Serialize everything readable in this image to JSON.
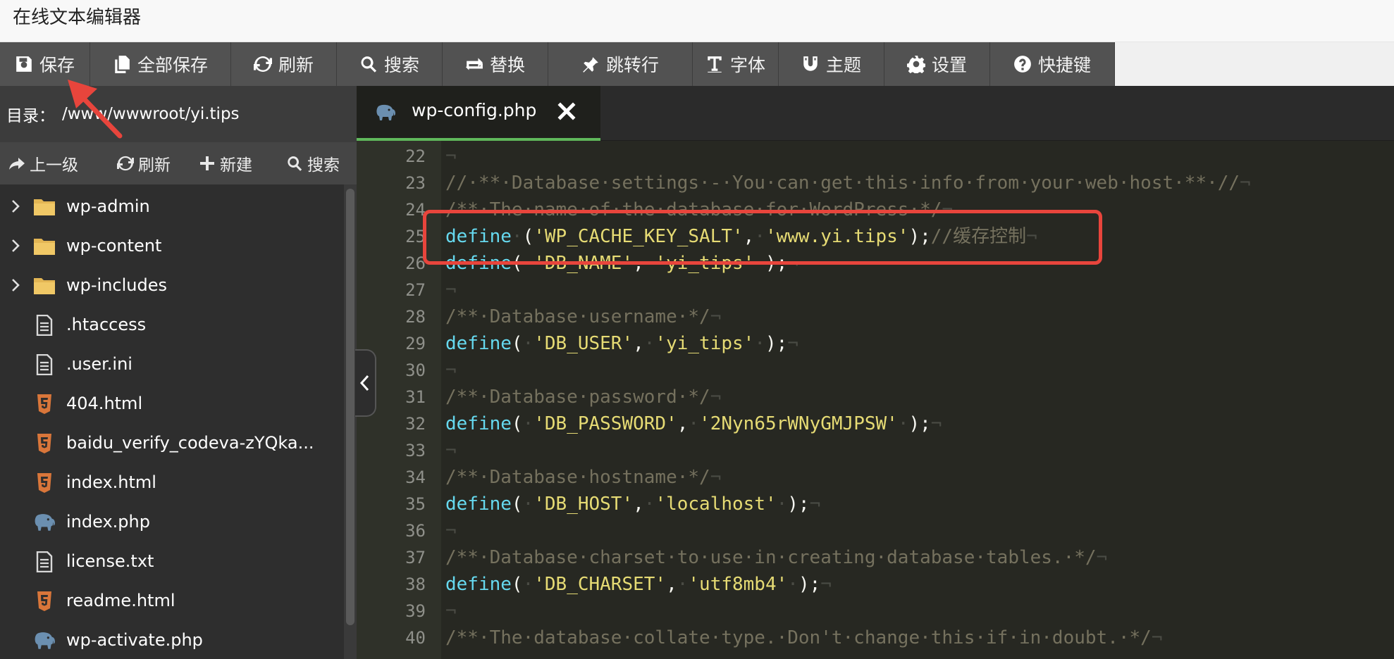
{
  "app": {
    "title": "在线文本编辑器"
  },
  "toolbar": {
    "save": "保存",
    "save_all": "全部保存",
    "refresh": "刷新",
    "search": "搜索",
    "replace": "替换",
    "goto_line": "跳转行",
    "font": "字体",
    "theme": "主题",
    "settings": "设置",
    "shortcuts": "快捷键"
  },
  "sidebar": {
    "dir_label": "目录：",
    "dir_path": "/www/wwwroot/yi.tips",
    "actions": {
      "up": "上一级",
      "refresh": "刷新",
      "new": "新建",
      "search": "搜索"
    },
    "files": [
      {
        "name": "wp-admin",
        "type": "folder"
      },
      {
        "name": "wp-content",
        "type": "folder"
      },
      {
        "name": "wp-includes",
        "type": "folder"
      },
      {
        "name": ".htaccess",
        "type": "text"
      },
      {
        "name": ".user.ini",
        "type": "text"
      },
      {
        "name": "404.html",
        "type": "html"
      },
      {
        "name": "baidu_verify_codeva-zYQka...",
        "type": "html"
      },
      {
        "name": "index.html",
        "type": "html"
      },
      {
        "name": "index.php",
        "type": "php"
      },
      {
        "name": "license.txt",
        "type": "text"
      },
      {
        "name": "readme.html",
        "type": "html"
      },
      {
        "name": "wp-activate.php",
        "type": "php"
      }
    ]
  },
  "editor": {
    "tab_name": "wp-config.php",
    "lines": [
      {
        "num": "22",
        "tokens": [
          {
            "t": "¬",
            "c": "inv"
          }
        ]
      },
      {
        "num": "23",
        "tokens": [
          {
            "t": "//·**·Database·settings·-·You·can·get·this·info·from·your·web·host·**·//",
            "c": "cm"
          },
          {
            "t": "¬",
            "c": "inv"
          }
        ]
      },
      {
        "num": "24",
        "tokens": [
          {
            "t": "/**·The·name·of·the·database·for·WordPress·*/",
            "c": "cm"
          },
          {
            "t": "¬",
            "c": "inv"
          }
        ]
      },
      {
        "num": "25",
        "tokens": [
          {
            "t": "define",
            "c": "kw"
          },
          {
            "t": "·",
            "c": "inv"
          },
          {
            "t": "(",
            "c": ""
          },
          {
            "t": "'WP_CACHE_KEY_SALT'",
            "c": "st"
          },
          {
            "t": ",",
            "c": ""
          },
          {
            "t": "·",
            "c": "inv"
          },
          {
            "t": "'www.yi.tips'",
            "c": "st"
          },
          {
            "t": ");",
            "c": ""
          },
          {
            "t": "//缓存控制",
            "c": "cm"
          },
          {
            "t": "¬",
            "c": "inv"
          }
        ]
      },
      {
        "num": "26",
        "tokens": [
          {
            "t": "define",
            "c": "kw"
          },
          {
            "t": "(",
            "c": ""
          },
          {
            "t": "·",
            "c": "inv"
          },
          {
            "t": "'DB_NAME'",
            "c": "st"
          },
          {
            "t": ",",
            "c": ""
          },
          {
            "t": "·",
            "c": "inv"
          },
          {
            "t": "'yi_tips'",
            "c": "st"
          },
          {
            "t": "·",
            "c": "inv"
          },
          {
            "t": ");",
            "c": ""
          },
          {
            "t": "¬",
            "c": "inv"
          }
        ]
      },
      {
        "num": "27",
        "tokens": [
          {
            "t": "¬",
            "c": "inv"
          }
        ]
      },
      {
        "num": "28",
        "tokens": [
          {
            "t": "/**·Database·username·*/",
            "c": "cm"
          },
          {
            "t": "¬",
            "c": "inv"
          }
        ]
      },
      {
        "num": "29",
        "tokens": [
          {
            "t": "define",
            "c": "kw"
          },
          {
            "t": "(",
            "c": ""
          },
          {
            "t": "·",
            "c": "inv"
          },
          {
            "t": "'DB_USER'",
            "c": "st"
          },
          {
            "t": ",",
            "c": ""
          },
          {
            "t": "·",
            "c": "inv"
          },
          {
            "t": "'yi_tips'",
            "c": "st"
          },
          {
            "t": "·",
            "c": "inv"
          },
          {
            "t": ");",
            "c": ""
          },
          {
            "t": "¬",
            "c": "inv"
          }
        ]
      },
      {
        "num": "30",
        "tokens": [
          {
            "t": "¬",
            "c": "inv"
          }
        ]
      },
      {
        "num": "31",
        "tokens": [
          {
            "t": "/**·Database·password·*/",
            "c": "cm"
          },
          {
            "t": "¬",
            "c": "inv"
          }
        ]
      },
      {
        "num": "32",
        "tokens": [
          {
            "t": "define",
            "c": "kw"
          },
          {
            "t": "(",
            "c": ""
          },
          {
            "t": "·",
            "c": "inv"
          },
          {
            "t": "'DB_PASSWORD'",
            "c": "st"
          },
          {
            "t": ",",
            "c": ""
          },
          {
            "t": "·",
            "c": "inv"
          },
          {
            "t": "'2Nyn65rWNyGMJPSW'",
            "c": "st"
          },
          {
            "t": "·",
            "c": "inv"
          },
          {
            "t": ");",
            "c": ""
          },
          {
            "t": "¬",
            "c": "inv"
          }
        ]
      },
      {
        "num": "33",
        "tokens": [
          {
            "t": "¬",
            "c": "inv"
          }
        ]
      },
      {
        "num": "34",
        "tokens": [
          {
            "t": "/**·Database·hostname·*/",
            "c": "cm"
          },
          {
            "t": "¬",
            "c": "inv"
          }
        ]
      },
      {
        "num": "35",
        "tokens": [
          {
            "t": "define",
            "c": "kw"
          },
          {
            "t": "(",
            "c": ""
          },
          {
            "t": "·",
            "c": "inv"
          },
          {
            "t": "'DB_HOST'",
            "c": "st"
          },
          {
            "t": ",",
            "c": ""
          },
          {
            "t": "·",
            "c": "inv"
          },
          {
            "t": "'localhost'",
            "c": "st"
          },
          {
            "t": "·",
            "c": "inv"
          },
          {
            "t": ");",
            "c": ""
          },
          {
            "t": "¬",
            "c": "inv"
          }
        ]
      },
      {
        "num": "36",
        "tokens": [
          {
            "t": "¬",
            "c": "inv"
          }
        ]
      },
      {
        "num": "37",
        "tokens": [
          {
            "t": "/**·Database·charset·to·use·in·creating·database·tables.·*/",
            "c": "cm"
          },
          {
            "t": "¬",
            "c": "inv"
          }
        ]
      },
      {
        "num": "38",
        "tokens": [
          {
            "t": "define",
            "c": "kw"
          },
          {
            "t": "(",
            "c": ""
          },
          {
            "t": "·",
            "c": "inv"
          },
          {
            "t": "'DB_CHARSET'",
            "c": "st"
          },
          {
            "t": ",",
            "c": ""
          },
          {
            "t": "·",
            "c": "inv"
          },
          {
            "t": "'utf8mb4'",
            "c": "st"
          },
          {
            "t": "·",
            "c": "inv"
          },
          {
            "t": ");",
            "c": ""
          },
          {
            "t": "¬",
            "c": "inv"
          }
        ]
      },
      {
        "num": "39",
        "tokens": [
          {
            "t": "¬",
            "c": "inv"
          }
        ]
      },
      {
        "num": "40",
        "tokens": [
          {
            "t": "/**·The·database·collate·type.·Don't·change·this·if·in·doubt.·*/",
            "c": "cm"
          },
          {
            "t": "¬",
            "c": "inv"
          }
        ]
      }
    ]
  },
  "colors": {
    "toolbar_bg": "#525252",
    "editor_bg": "#272822",
    "keyword": "#66d9ef",
    "string": "#e6db74",
    "comment": "#75715e",
    "tab_active_underline": "#5fb85b",
    "annotation_red": "#e8453c"
  }
}
